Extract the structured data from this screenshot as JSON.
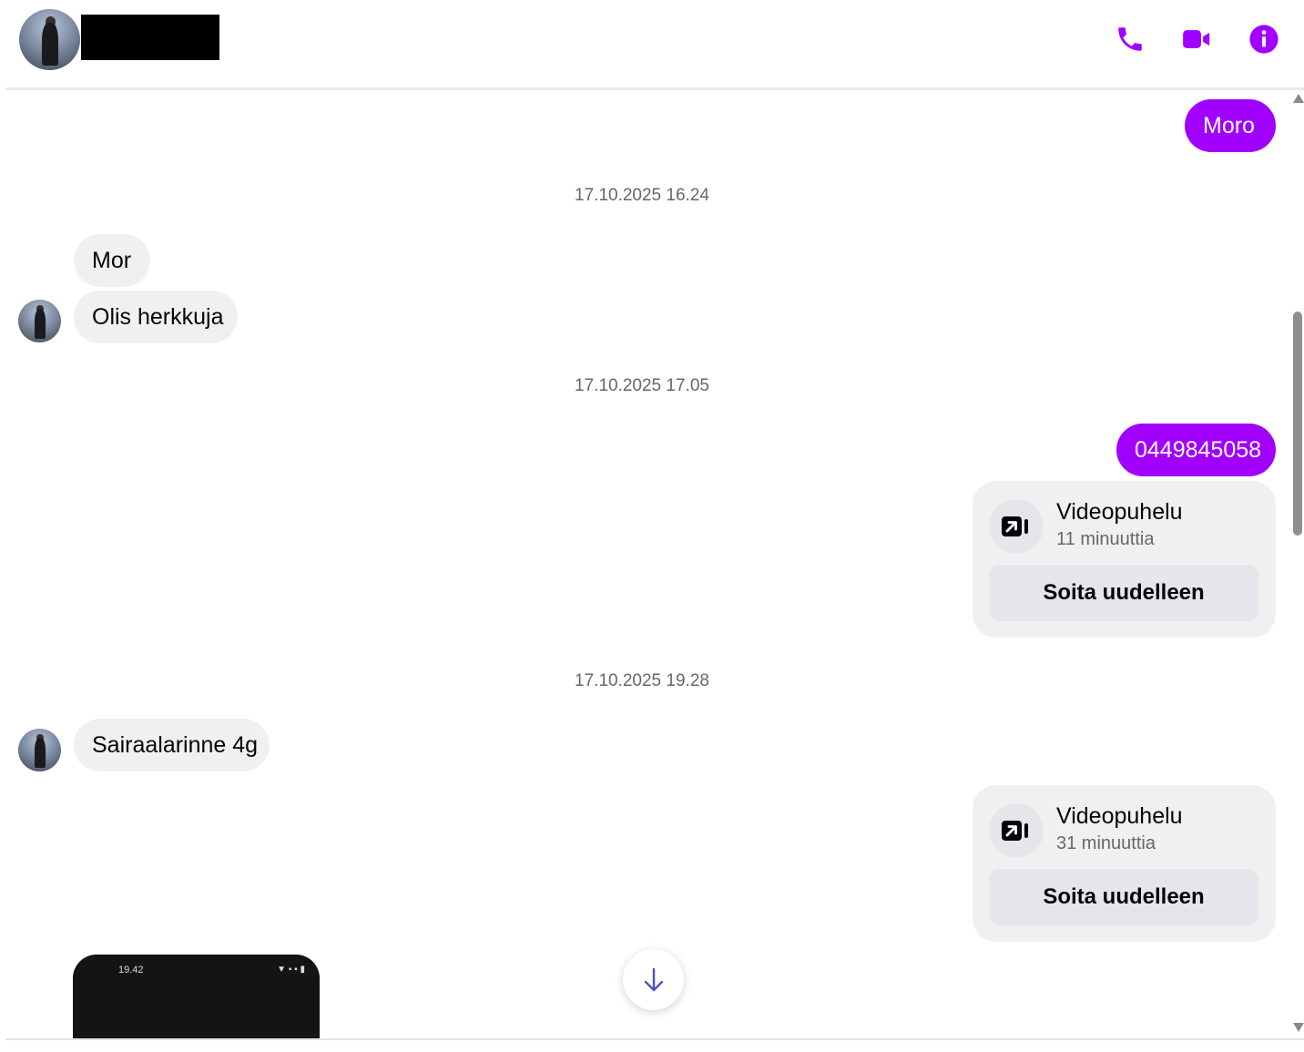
{
  "header": {
    "contact_name": "",
    "icons": [
      "phone-icon",
      "video-camera-icon",
      "info-icon"
    ]
  },
  "theme": {
    "accent": "#a100ff",
    "incoming_bubble": "#f0f0f0",
    "muted_text": "#65676b"
  },
  "messages": {
    "m1": "Moro",
    "ts1": "17.10.2025 16.24",
    "m2": "Mor",
    "m3": "Olis herkkuja",
    "ts2": "17.10.2025 17.05",
    "m4": "0449845058",
    "call1": {
      "title": "Videopuhelu",
      "duration": "11 minuuttia",
      "button": "Soita uudelleen"
    },
    "ts3": "17.10.2025 19.28",
    "m5": "Sairaalarinne 4g",
    "call2": {
      "title": "Videopuhelu",
      "duration": "31 minuuttia",
      "button": "Soita uudelleen"
    },
    "screenshot": {
      "time": "19.42"
    }
  }
}
